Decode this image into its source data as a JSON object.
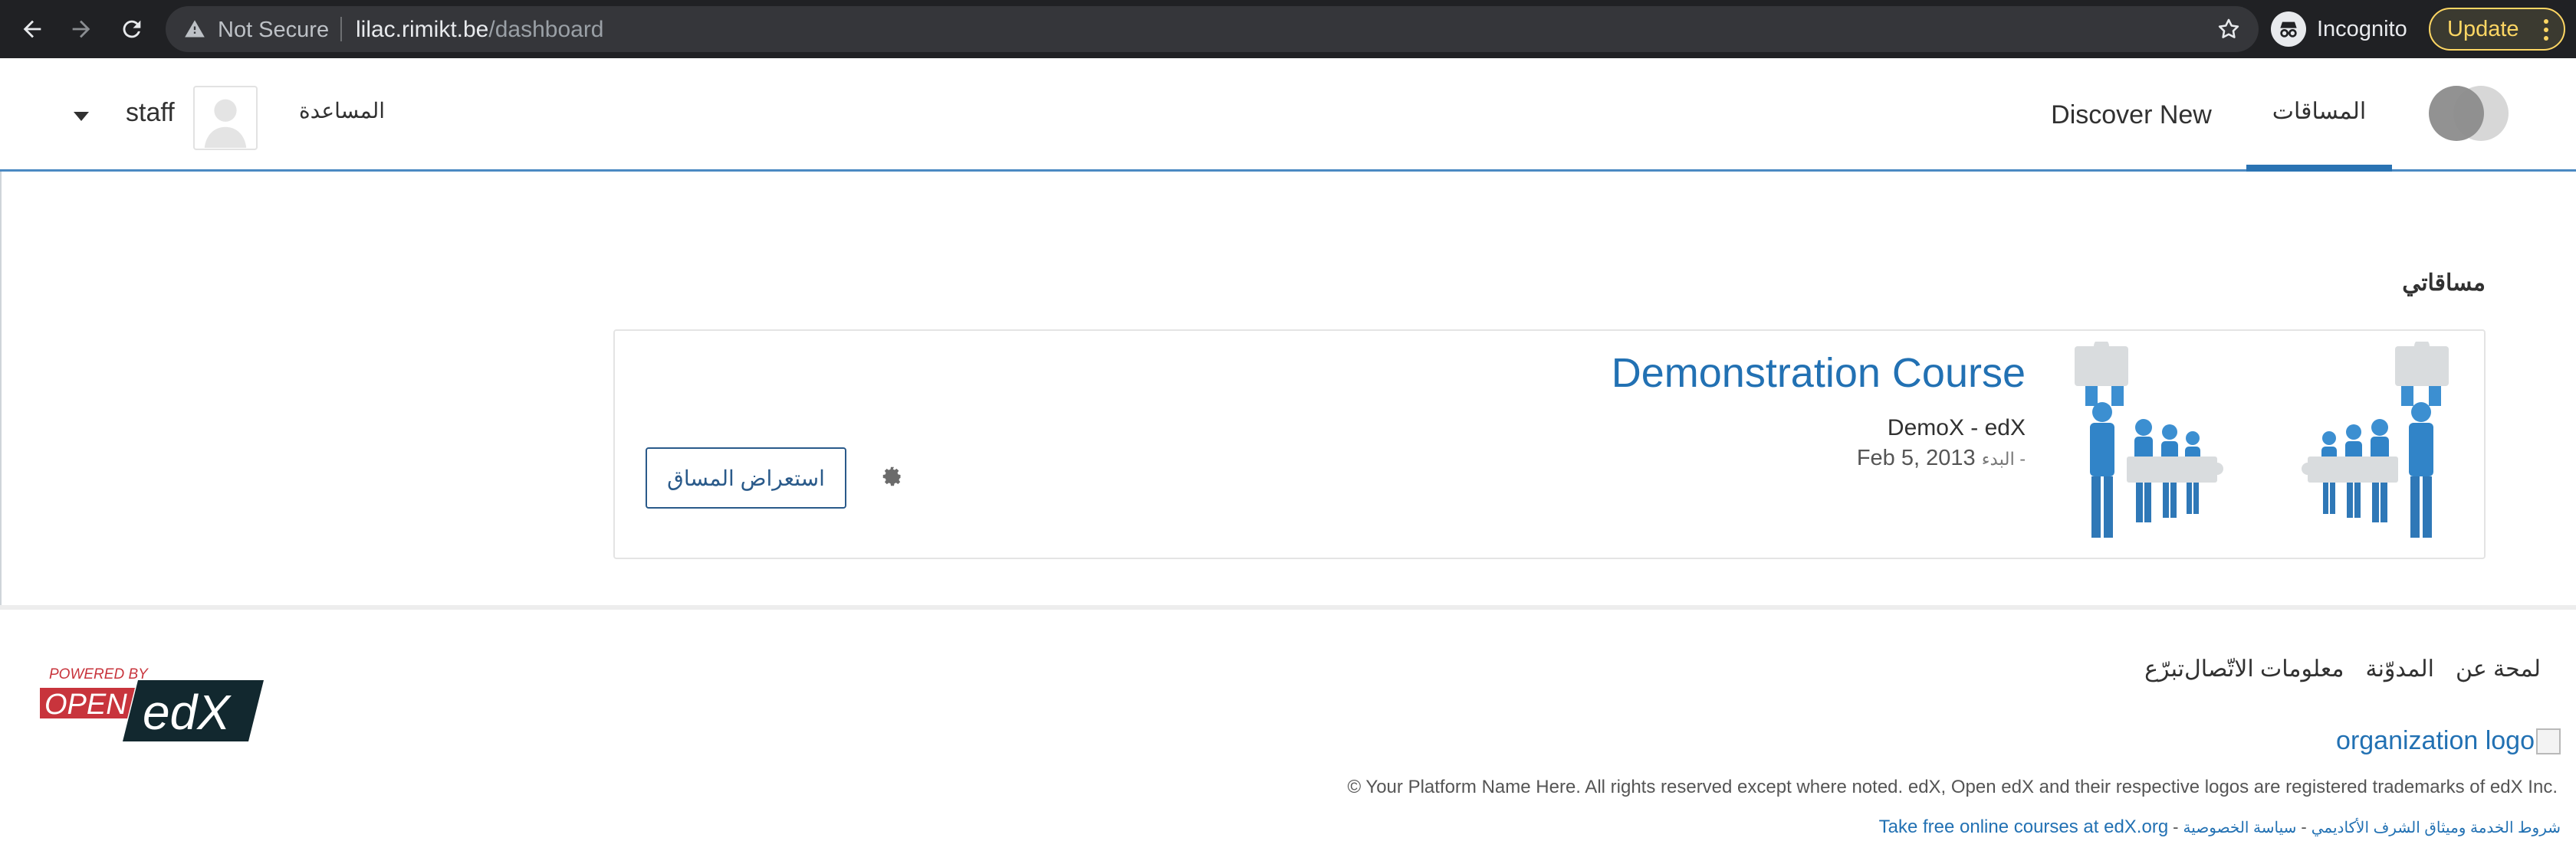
{
  "browser": {
    "not_secure_label": "Not Secure",
    "url_host": "lilac.rimikt.be",
    "url_path": "/dashboard",
    "incognito_label": "Incognito",
    "update_label": "Update",
    "icons": [
      "back-arrow-icon",
      "forward-arrow-icon",
      "reload-icon",
      "warning-icon",
      "star-icon",
      "incognito-icon",
      "kebab-menu-icon"
    ]
  },
  "header": {
    "nav": {
      "courses_label": "المساقات",
      "discover_label": "Discover New"
    },
    "user": {
      "help_label": "المساعدة",
      "username": "staff"
    },
    "active_tab_color": "#2a73b3"
  },
  "main": {
    "section_title": "مساقاتي",
    "course": {
      "title": "Demonstration Course",
      "org_line": "DemoX - edX",
      "start_label": "البدء -",
      "start_date": "Feb 5, 2013",
      "view_button_label": "استعراض المساق",
      "title_color": "#2271b3"
    }
  },
  "footer": {
    "nav_items": [
      "لمحة عن",
      "المدوّنة",
      "معلومات الاتّصال",
      "تبرّع"
    ],
    "powered_by_text": "POWERED BY",
    "powered_open_text": "OPEN",
    "powered_edx_text": "edX",
    "org_logo_alt": "organization logo",
    "copyright": "© Your Platform Name Here. All rights reserved except where noted. edX, Open edX and their respective logos are registered trademarks of edX Inc.",
    "legal": {
      "terms_label": "شروط الخدمة وميثاق الشرف الأكاديمي",
      "privacy_label": "سياسة الخصوصية",
      "edx_link_label": "Take free online courses at edX.org",
      "separator": "-"
    }
  }
}
